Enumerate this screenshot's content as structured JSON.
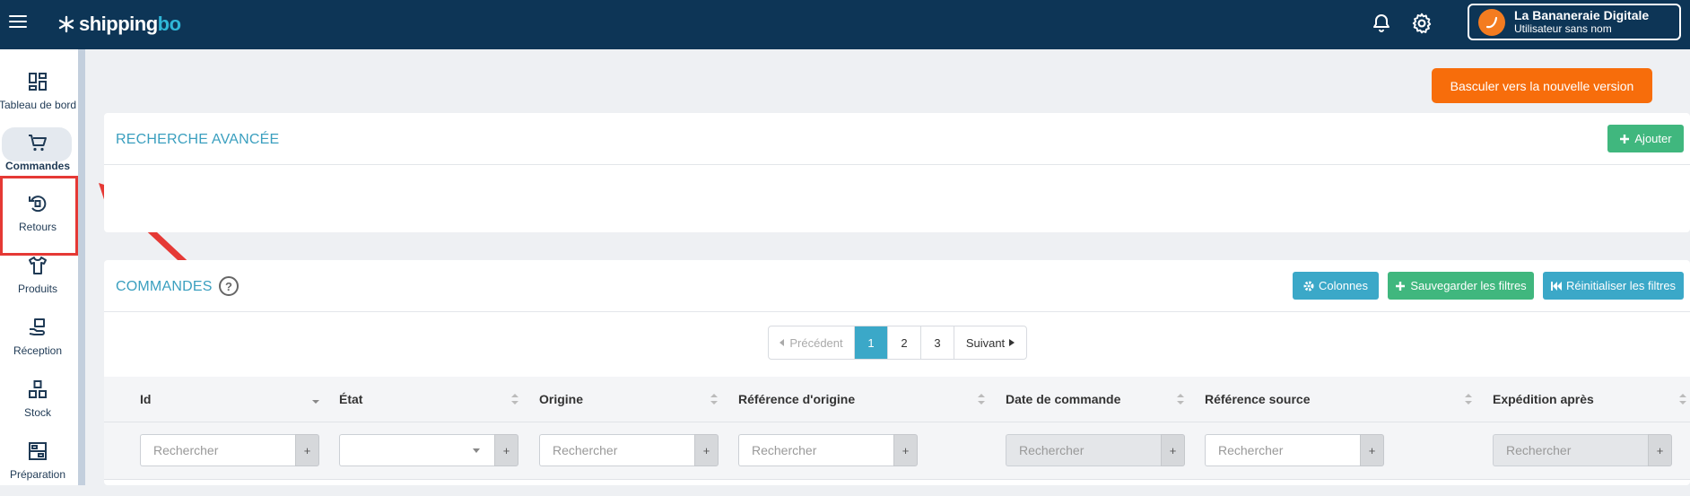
{
  "app": {
    "logo_main": "shipping",
    "logo_accent": "bo"
  },
  "account": {
    "name": "La Bananeraie Digitale",
    "user": "Utilisateur sans nom"
  },
  "sidebar": {
    "items": [
      {
        "label": "Tableau de bord",
        "icon": "dashboard-icon"
      },
      {
        "label": "Commandes",
        "icon": "cart-icon",
        "active": true
      },
      {
        "label": "Retours",
        "icon": "return-icon"
      },
      {
        "label": "Produits",
        "icon": "tshirt-icon"
      },
      {
        "label": "Réception",
        "icon": "reception-icon"
      },
      {
        "label": "Stock",
        "icon": "stock-icon"
      },
      {
        "label": "Préparation",
        "icon": "preparation-icon"
      }
    ]
  },
  "actions": {
    "new_version": "Basculer vers la nouvelle version"
  },
  "advanced_search": {
    "title": "RECHERCHE AVANCÉE",
    "add_label": "Ajouter"
  },
  "orders": {
    "title": "COMMANDES",
    "help": "?",
    "columns_btn": "Colonnes",
    "save_filters_btn": "Sauvegarder les filtres",
    "reset_filters_btn": "Réinitialiser les filtres",
    "pagination": {
      "prev": "Précédent",
      "pages": [
        "1",
        "2",
        "3"
      ],
      "current": "1",
      "next": "Suivant"
    },
    "table": {
      "headers": [
        "Id",
        "État",
        "Origine",
        "Référence d'origine",
        "Date de commande",
        "Référence source",
        "Expédition après"
      ],
      "filter_placeholder": "Rechercher",
      "plus": "+"
    }
  },
  "colors": {
    "topbar": "#0d3556",
    "accent_orange": "#f76d0b",
    "teal": "#3ba8c8",
    "green": "#40b77e",
    "annotation_red": "#e53935"
  }
}
